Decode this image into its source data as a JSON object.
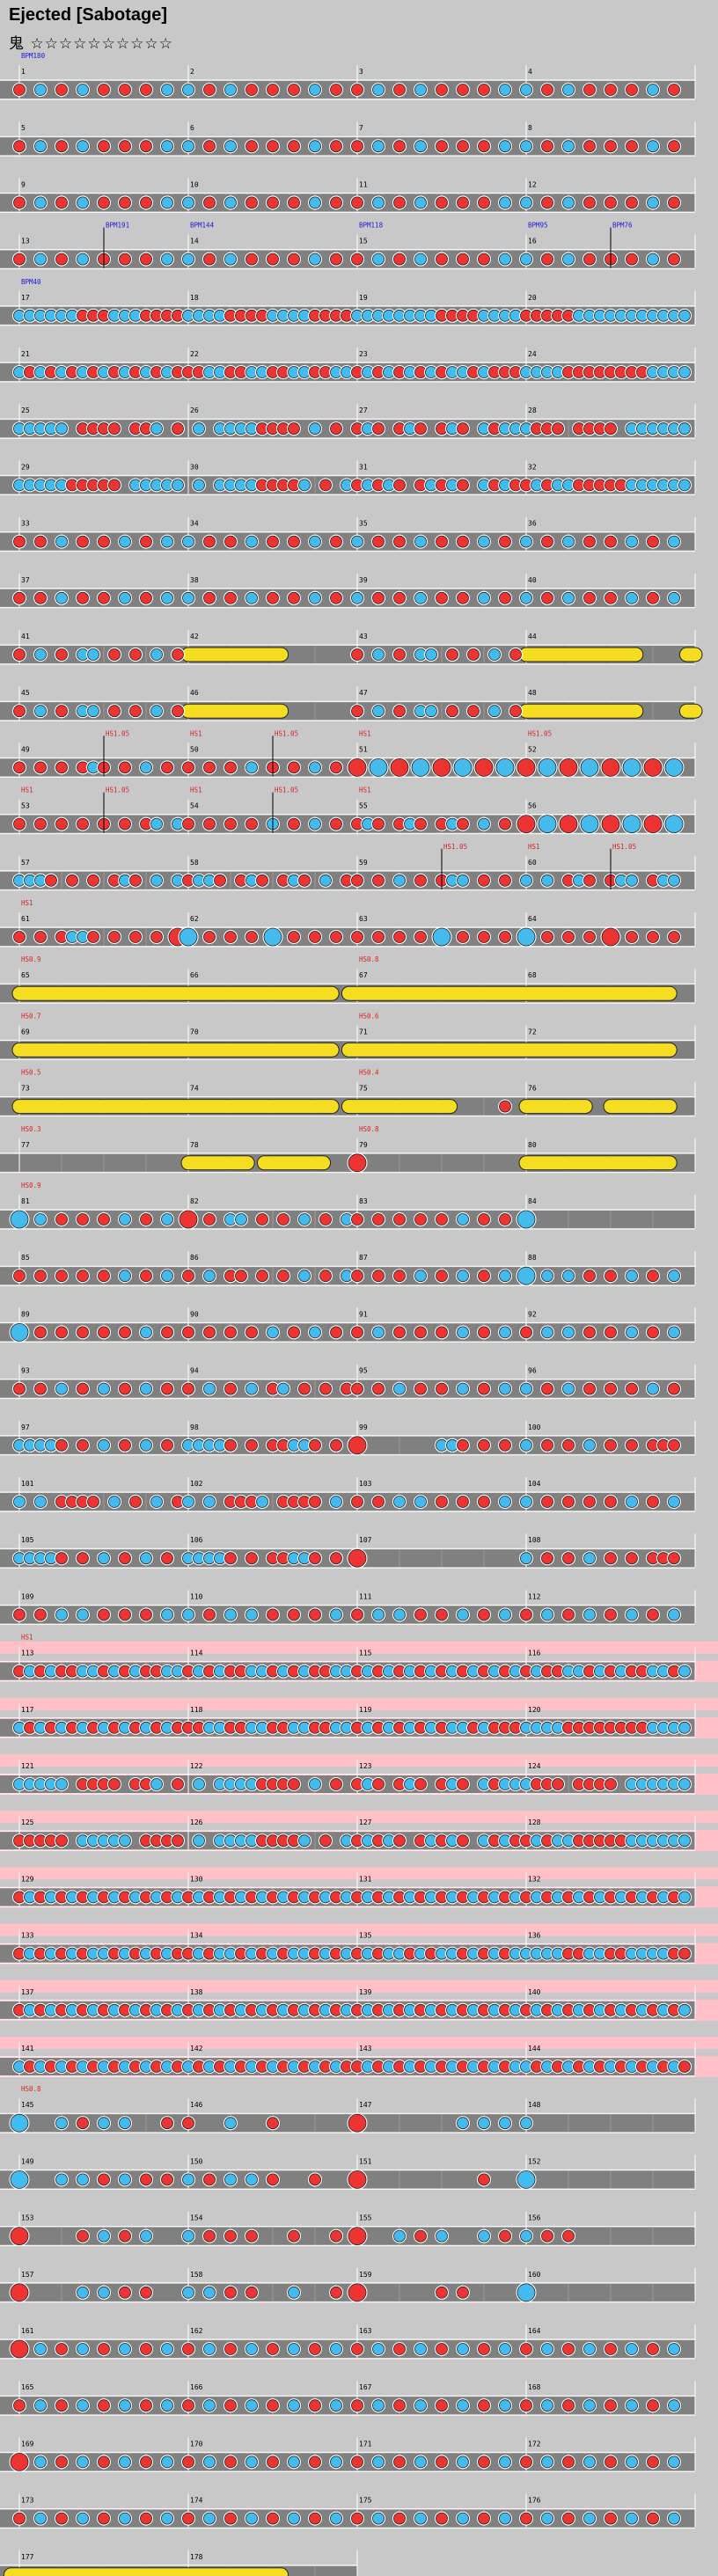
{
  "header": {
    "title": "Ejected [Sabotage]",
    "difficulty": "鬼 ☆☆☆☆☆☆☆☆☆☆"
  },
  "colors": {
    "don": "#ee3333",
    "ka": "#44bbee",
    "roll": "#f5dd22",
    "gogo": "#ffc0c8",
    "lane": "#808080"
  },
  "chart": {
    "measure_count": 178,
    "per_row": 4
  },
  "markers": [
    {
      "measure": 1,
      "text": "BPM180",
      "kind": "bpm"
    },
    {
      "measure": 13,
      "text": "BPM191",
      "kind": "bpm",
      "offset": 0.5
    },
    {
      "measure": 14,
      "text": "BPM144",
      "kind": "bpm"
    },
    {
      "measure": 15,
      "text": "BPM118",
      "kind": "bpm"
    },
    {
      "measure": 16,
      "text": "BPM95",
      "kind": "bpm"
    },
    {
      "measure": 16,
      "text": "BPM76",
      "kind": "bpm",
      "offset": 0.5
    },
    {
      "measure": 17,
      "text": "BPM40",
      "kind": "bpm"
    },
    {
      "measure": 49,
      "text": "HS1.05",
      "kind": "hs",
      "offset": 0.5
    },
    {
      "measure": 50,
      "text": "HS1",
      "kind": "hs"
    },
    {
      "measure": 50,
      "text": "HS1.05",
      "kind": "hs",
      "offset": 0.5
    },
    {
      "measure": 51,
      "text": "HS1",
      "kind": "hs"
    },
    {
      "measure": 52,
      "text": "HS1.05",
      "kind": "hs"
    },
    {
      "measure": 53,
      "text": "HS1",
      "kind": "hs"
    },
    {
      "measure": 53,
      "text": "HS1.05",
      "kind": "hs",
      "offset": 0.5
    },
    {
      "measure": 54,
      "text": "HS1",
      "kind": "hs"
    },
    {
      "measure": 54,
      "text": "HS1.05",
      "kind": "hs",
      "offset": 0.5
    },
    {
      "measure": 55,
      "text": "HS1",
      "kind": "hs"
    },
    {
      "measure": 59,
      "text": "HS1.05",
      "kind": "hs",
      "offset": 0.5
    },
    {
      "measure": 60,
      "text": "HS1",
      "kind": "hs"
    },
    {
      "measure": 60,
      "text": "HS1.05",
      "kind": "hs",
      "offset": 0.5
    },
    {
      "measure": 61,
      "text": "HS1",
      "kind": "hs"
    },
    {
      "measure": 65,
      "text": "HS0.9",
      "kind": "hs"
    },
    {
      "measure": 67,
      "text": "HS0.8",
      "kind": "hs"
    },
    {
      "measure": 69,
      "text": "HS0.7",
      "kind": "hs"
    },
    {
      "measure": 71,
      "text": "HS0.6",
      "kind": "hs"
    },
    {
      "measure": 73,
      "text": "HS0.5",
      "kind": "hs"
    },
    {
      "measure": 75,
      "text": "HS0.4",
      "kind": "hs"
    },
    {
      "measure": 77,
      "text": "HS0.3",
      "kind": "hs"
    },
    {
      "measure": 79,
      "text": "HS0.8",
      "kind": "hs"
    },
    {
      "measure": 81,
      "text": "HS0.9",
      "kind": "hs"
    },
    {
      "measure": 113,
      "text": "HS1",
      "kind": "hs"
    },
    {
      "measure": 145,
      "text": "HS0.8",
      "kind": "hs"
    }
  ],
  "gogo_rows": [
    28,
    29,
    30,
    31,
    32,
    33,
    34,
    35
  ],
  "rolls": [
    {
      "start": 42,
      "from": 0.0,
      "to": 0.55
    },
    {
      "start": 44,
      "from": 0.0,
      "to": 0.65
    },
    {
      "start": 44,
      "from": 0.95,
      "to": 1.0
    },
    {
      "start": 46,
      "from": 0.0,
      "to": 0.55
    },
    {
      "start": 48,
      "from": 0.0,
      "to": 0.65
    },
    {
      "start": 48,
      "from": 0.95,
      "to": 1.0
    },
    {
      "start": 65,
      "from": 0.0,
      "to": 1.85
    },
    {
      "start": 67,
      "from": -0.05,
      "to": 1.85
    },
    {
      "start": 69,
      "from": 0.0,
      "to": 1.85
    },
    {
      "start": 71,
      "from": -0.05,
      "to": 1.85
    },
    {
      "start": 73,
      "from": 0.0,
      "to": 1.85
    },
    {
      "start": 75,
      "from": -0.05,
      "to": 0.55
    },
    {
      "start": 76,
      "from": 0.0,
      "to": 0.35
    },
    {
      "start": 76,
      "from": 0.5,
      "to": 0.85
    },
    {
      "start": 78,
      "from": 0.0,
      "to": 0.35
    },
    {
      "start": 78,
      "from": 0.45,
      "to": 0.8
    },
    {
      "start": 80,
      "from": 0.0,
      "to": 0.85
    },
    {
      "start": 177,
      "from": -0.05,
      "to": 1.55
    }
  ],
  "row_patterns": [
    "d.k.d.k.d.d.d.k.|k.d.k.d.d.d.k.d.|d.k.d.k.d.d.d.k.|k.d.k.d.d.d.k.d.",
    "d.k.d.k.d.d.d.k.|k.d.k.d.d.d.k.d.|d.k.d.k.d.d.d.k.|k.d.k.d.d.d.k.d.",
    "d.k.d.k.d.d.d.k.|k.d.k.d.d.d.k.d.|d.k.d.k.d.d.d.k.|k.d.k.d.d.d.k.d.",
    "d.k.d.k.d.d.d.k.|k.d.k.d.d.d.k.d.|d.k.d.k.d.d.d.k.|k.d.k.d.d.d.k.d.",
    "kkkkkkdddkkkdddd|kkkkddddkkkkdddd|kkkkkkkkddddkkkk|dddddkkkkkkkkkkk",
    "kdkdkdkdkdkdkdkd|ddkkddkkddkkddkk|dkdkdkdkdkkdkddd|kkkkddddddddkkkk",
    "kkkkk.dddd.ddk.d|.k.kkkkdddd.k.d.|dkd.dkd.dkd.kdkk|kddd.dddd.kkkkkk",
    "kkkkkddddd.kkkkk|.k.kkkkddddk.d.k|dkdkd.dkdkd.kdkd|dkdkkdddddkkkkkk",
    "d.d.k.d.d.k.d.k.|k.d.d.k.d.d.k.d.|k.d.d.k.d.d.k.d.|k.d.k.d.d.k.d.k.",
    "d.d.k.d.d.k.d.k.|k.d.d.k.d.d.k.d.|k.d.d.k.d.d.k.d.|k.d.k.d.d.k.d.k.",
    "d.k.d.kk.d.d.k.d|................|d.k.d.kk.d.d.k.d|................",
    "d.k.d.kk.d.d.k.d|................|d.k.d.kk.d.d.k.d|................",
    "d.d.d.dkd.d.k.d.|d.d.d.k.d.d.k.d.|D.K.D.K.D.K.D.K.|D.K.D.K.D.K.D.K.",
    "d.d.d.d.d.d.dk.k|d.d.d.d.k.d.k.d.|dkd.dkd.dkd.k.d.|D.K.D.K.D.K.D.K.",
    "kkkd.d.d.dkd.k.k|dkkd.dkd.dkd.k.d|d.d.k.d.dkk.d.d.|k.k.dkd.dkk.dkk.",
    "d.d.dkkd.d.d.d.D|K.d.d.d.K.d.d.d.|d.d.d.d.K.d.d.d.|K.d.d.d.D.d.d.d.",
    "................|................|................|................",
    "................|................|................|................",
    "................|................|..............d.|................",
    "................|................|D...............|................",
    "K.k.d.d.d.k.d.k.|D.d.kk.d.d.k.d.k|d.d.d.d.d.k.d.d.|K...............",
    "d.d.d.d.d.k.d.k.|d.k.dd.d.d.k.d.k|d.d.d.k.d.k.d.k.|K.k.k.d.d.k.d.k.",
    "K.d.d.d.d.d.k.d.|d.d.d.d.k.d.k.d.|d.k.d.d.d.k.d.k.|d.k.k.d.d.k.d.k.",
    "d.d.k.d.k.d.k.d.|d.k.d.k.dk.d.d.d|d.d.k.d.d.k.d.k.|k.d.k.d.d.d.k.d.",
    "kkkkd.d.k.d.k.d.|kkkkd.d.ddkkd.d.|D.......kkd.d.d.|k.d.d.k.d.d.ddd.",
    "k.k.dddd.k.d.k.d|k.k.dddk.dddd.k.|d.d.k.k.d.d.d.k.|k.d.d.d.d.k.d.k.",
    "kkkkd.d.k.d.k.d.|kkkkd.d.ddkkd.d.|D...............|k.d.d.k.d.d.ddd.",
    "d.d.k.k.d.d.d.k.|k.d.k.k.d.d.d.k.|d.k.k.d.d.k.d.k.|d.k.d.k.d.k.d.k.",
    "dkdkddkkdkdkddkk|dkdkddkkdkdkddkk|dkdkdkdkdkdkdkdk|dkddkkdkdkddkkdk",
    "kdkdkdkdkdkdkdkd|ddkkddkkddkkddkk|dkdkdkdkdkkdkddd|kkkkddddddddkkkk",
    "kkkkk.dddd.ddk.d|.k.kkkkdddd.k.d.|dkd.dkd.dkd.kdkk|kddd.dddd.kkkkkk",
    "ddddd.kkkkk.dddd|.k.kkkkddddk.d.k|dkdkd.dkdkd.kdkd|dkdkkdddddkkkkkk",
    "dkdkdkdkdkdkdkdk|dkdkdkdkdkdkdkdk|dkdkdkdkdkdkdkdk|dkdkdkdkdkdkdkdk",
    "dkdkdkdkkdkdkdkd|dkdkkdkdkdkkdkdk|dkdkkdkdkkdkdkdk|kkkkddkkddkkkkdd",
    "dkdkdkdkdkdkdkdk|dkdkdkdkdkdkdkdk|dkdkdkdkdkdkdkdk|dkdkdkdkdkdkdkdk",
    "kdkdkdkdkdkdkdkd|kdkdkdkdkdkdkdkd|dkdkdkdkdkdkdkdk|kdkdkdkdkdkdkdkd",
    "K...k.d.k.k...d.|d...k...d.......|D.........k.k.k.|k...............",
    "K...k.k.d.k.d.d.|k.d.k.k.d...d...|D...........d...|K...............",
    "D.....d.k.d.k...|k.d.d.d...d...d.|D...k.d.k...k.d.|k.d.d...........",
    "D.....k.k.d.d...|k.k.d.d...k...d.|D.......d.d.....|K...............",
    "D.k.d.k.d.k.d.k.|d.k.d.k.d.k.d.k.|d.k.d.k.d.k.d.k.|d.k.d.k.d.k.d.k.",
    "d.k.d.k.d.k.d.k.|d.k.d.k.d.k.d.k.|d.k.d.k.d.k.d.k.|d.k.d.k.d.k.d.k.",
    "D.k.d.k.d.k.d.k.|d.k.d.k.d.k.d.k.|d.k.d.k.d.k.d.k.|d.k.d.k.d.k.d.k.",
    "d.k.d.k.d.k.d.k.|d.k.d.k.d.k.d.k.|d.k.d.k.d.k.d.k.|d.k.d.k.d.k.d.k.",
    "................|................|................|................"
  ]
}
